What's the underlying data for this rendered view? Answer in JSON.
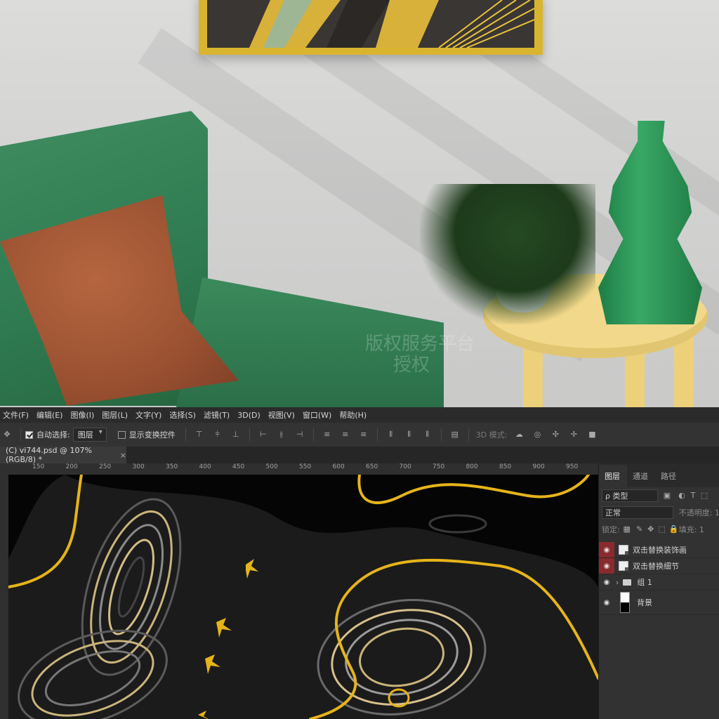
{
  "menu": {
    "items": [
      "文件(F)",
      "编辑(E)",
      "图像(I)",
      "图层(L)",
      "文字(Y)",
      "选择(S)",
      "滤镜(T)",
      "3D(D)",
      "视图(V)",
      "窗口(W)",
      "帮助(H)"
    ]
  },
  "options": {
    "auto_select_label": "自动选择:",
    "auto_select_target": "图层",
    "show_transform_label": "显示变换控件",
    "mode_3d_label": "3D 模式:"
  },
  "document": {
    "tab_title": "(C) vi744.psd @ 107%(RGB/8) *",
    "close_glyph": "×"
  },
  "ruler": {
    "ticks": [
      "150",
      "200",
      "250",
      "300",
      "350",
      "400",
      "450",
      "500",
      "550",
      "600",
      "650",
      "700",
      "750",
      "800",
      "850",
      "900",
      "950"
    ]
  },
  "layers_panel": {
    "tabs": [
      "图层",
      "通道",
      "路径"
    ],
    "filter_label": "ρ 类型",
    "blend_mode": "正常",
    "opacity_label": "不透明度: 1",
    "lock_label": "锁定:",
    "fill_label": "填充: 1",
    "layers": [
      {
        "name": "双击替换装饰画",
        "kind": "smart"
      },
      {
        "name": "双击替换细节",
        "kind": "smart"
      },
      {
        "name": "组 1",
        "kind": "group"
      },
      {
        "name": "背景",
        "kind": "background"
      }
    ]
  },
  "watermark": {
    "line1": "版权服务平台",
    "line2": "授权"
  },
  "colors": {
    "chair_green": "#2f7a51",
    "pillow_brown": "#9c5232",
    "table_yellow": "#f1d88a",
    "frame_gold": "#d9b52f",
    "canvas_gold": "#e6b41a",
    "layer_highlight": "#8a2a2e"
  }
}
